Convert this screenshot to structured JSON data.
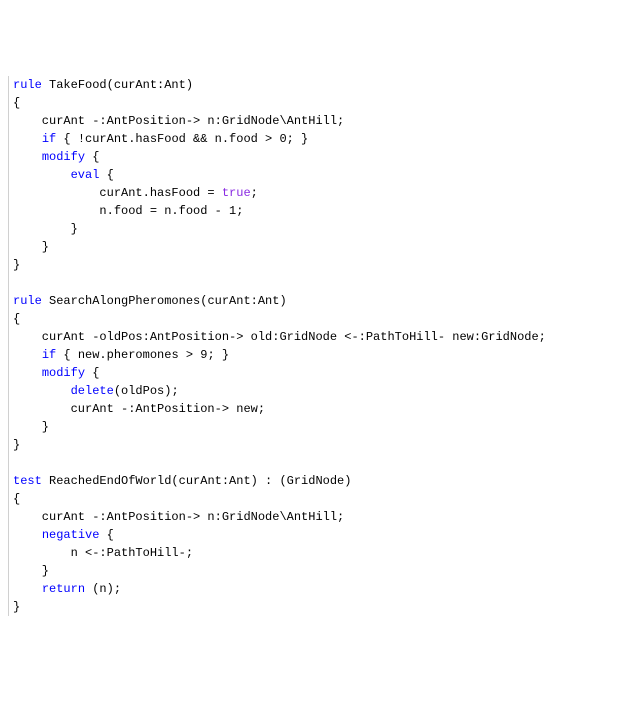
{
  "code": {
    "rule1": {
      "kw_rule": "rule",
      "name": " TakeFood(curAnt:Ant)",
      "lbrace": "{",
      "line1a": "    curAnt -:AntPosition-> n:GridNode\\AntHill;",
      "kw_if": "if",
      "line2rest": " { !curAnt.hasFood && n.food > 0; }",
      "blank": "",
      "kw_modify": "modify",
      "mod_open": " {",
      "kw_eval": "eval",
      "eval_open": " {",
      "eval_l1a": "            curAnt.hasFood = ",
      "kw_true": "true",
      "eval_l1b": ";",
      "eval_l2": "            n.food = n.food - 1;",
      "eval_close": "        }",
      "mod_close": "    }",
      "rbrace": "}"
    },
    "rule2": {
      "kw_rule": "rule",
      "name": " SearchAlongPheromones(curAnt:Ant)",
      "lbrace": "{",
      "line1": "    curAnt -oldPos:AntPosition-> old:GridNode <-:PathToHill- new:GridNode;",
      "kw_if": "if",
      "line2rest": " { new.pheromones > 9; }",
      "blank": "",
      "kw_modify": "modify",
      "mod_open": " {",
      "kw_delete": "delete",
      "del_rest": "(oldPos);",
      "mod_l2": "        curAnt -:AntPosition-> new;",
      "mod_close": "    }",
      "rbrace": "}"
    },
    "rule3": {
      "kw_test": "test",
      "name": " ReachedEndOfWorld(curAnt:Ant) : (GridNode)",
      "lbrace": "{",
      "line1": "    curAnt -:AntPosition-> n:GridNode\\AntHill;",
      "kw_negative": "negative",
      "neg_open": " {",
      "neg_l1": "        n <-:PathToHill-;",
      "neg_close": "    }",
      "kw_return": "return",
      "ret_rest": " (n);",
      "rbrace": "}"
    }
  }
}
